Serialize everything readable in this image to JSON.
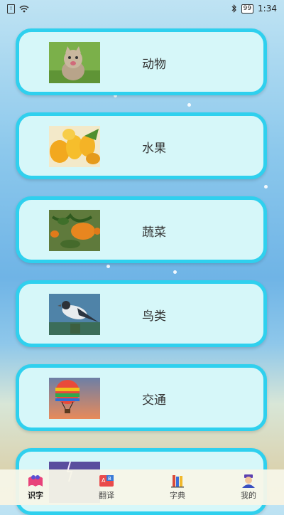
{
  "status_bar": {
    "time": "1:34",
    "battery": "99"
  },
  "categories": [
    {
      "label": "动物",
      "icon": "kitten-photo"
    },
    {
      "label": "水果",
      "icon": "mango-photo"
    },
    {
      "label": "蔬菜",
      "icon": "tomato-plant-photo"
    },
    {
      "label": "鸟类",
      "icon": "bird-photo"
    },
    {
      "label": "交通",
      "icon": "hot-air-balloon-photo"
    },
    {
      "label": "",
      "icon": "lightning-photo"
    }
  ],
  "tabs": [
    {
      "label": "识字",
      "icon": "open-book-icon",
      "active": true
    },
    {
      "label": "翻译",
      "icon": "abc-blocks-icon",
      "active": false
    },
    {
      "label": "字典",
      "icon": "books-icon",
      "active": false
    },
    {
      "label": "我的",
      "icon": "user-avatar-icon",
      "active": false
    }
  ],
  "colors": {
    "card_border": "#2fd0ee",
    "card_fill": "#d6f7f9"
  }
}
